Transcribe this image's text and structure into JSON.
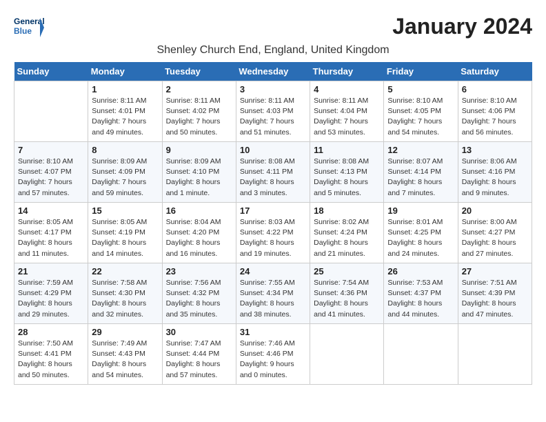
{
  "header": {
    "logo_general": "General",
    "logo_blue": "Blue",
    "month": "January 2024",
    "location": "Shenley Church End, England, United Kingdom"
  },
  "weekdays": [
    "Sunday",
    "Monday",
    "Tuesday",
    "Wednesday",
    "Thursday",
    "Friday",
    "Saturday"
  ],
  "weeks": [
    [
      {
        "day": "",
        "sunrise": "",
        "sunset": "",
        "daylight": ""
      },
      {
        "day": "1",
        "sunrise": "Sunrise: 8:11 AM",
        "sunset": "Sunset: 4:01 PM",
        "daylight": "Daylight: 7 hours and 49 minutes."
      },
      {
        "day": "2",
        "sunrise": "Sunrise: 8:11 AM",
        "sunset": "Sunset: 4:02 PM",
        "daylight": "Daylight: 7 hours and 50 minutes."
      },
      {
        "day": "3",
        "sunrise": "Sunrise: 8:11 AM",
        "sunset": "Sunset: 4:03 PM",
        "daylight": "Daylight: 7 hours and 51 minutes."
      },
      {
        "day": "4",
        "sunrise": "Sunrise: 8:11 AM",
        "sunset": "Sunset: 4:04 PM",
        "daylight": "Daylight: 7 hours and 53 minutes."
      },
      {
        "day": "5",
        "sunrise": "Sunrise: 8:10 AM",
        "sunset": "Sunset: 4:05 PM",
        "daylight": "Daylight: 7 hours and 54 minutes."
      },
      {
        "day": "6",
        "sunrise": "Sunrise: 8:10 AM",
        "sunset": "Sunset: 4:06 PM",
        "daylight": "Daylight: 7 hours and 56 minutes."
      }
    ],
    [
      {
        "day": "7",
        "sunrise": "Sunrise: 8:10 AM",
        "sunset": "Sunset: 4:07 PM",
        "daylight": "Daylight: 7 hours and 57 minutes."
      },
      {
        "day": "8",
        "sunrise": "Sunrise: 8:09 AM",
        "sunset": "Sunset: 4:09 PM",
        "daylight": "Daylight: 7 hours and 59 minutes."
      },
      {
        "day": "9",
        "sunrise": "Sunrise: 8:09 AM",
        "sunset": "Sunset: 4:10 PM",
        "daylight": "Daylight: 8 hours and 1 minute."
      },
      {
        "day": "10",
        "sunrise": "Sunrise: 8:08 AM",
        "sunset": "Sunset: 4:11 PM",
        "daylight": "Daylight: 8 hours and 3 minutes."
      },
      {
        "day": "11",
        "sunrise": "Sunrise: 8:08 AM",
        "sunset": "Sunset: 4:13 PM",
        "daylight": "Daylight: 8 hours and 5 minutes."
      },
      {
        "day": "12",
        "sunrise": "Sunrise: 8:07 AM",
        "sunset": "Sunset: 4:14 PM",
        "daylight": "Daylight: 8 hours and 7 minutes."
      },
      {
        "day": "13",
        "sunrise": "Sunrise: 8:06 AM",
        "sunset": "Sunset: 4:16 PM",
        "daylight": "Daylight: 8 hours and 9 minutes."
      }
    ],
    [
      {
        "day": "14",
        "sunrise": "Sunrise: 8:05 AM",
        "sunset": "Sunset: 4:17 PM",
        "daylight": "Daylight: 8 hours and 11 minutes."
      },
      {
        "day": "15",
        "sunrise": "Sunrise: 8:05 AM",
        "sunset": "Sunset: 4:19 PM",
        "daylight": "Daylight: 8 hours and 14 minutes."
      },
      {
        "day": "16",
        "sunrise": "Sunrise: 8:04 AM",
        "sunset": "Sunset: 4:20 PM",
        "daylight": "Daylight: 8 hours and 16 minutes."
      },
      {
        "day": "17",
        "sunrise": "Sunrise: 8:03 AM",
        "sunset": "Sunset: 4:22 PM",
        "daylight": "Daylight: 8 hours and 19 minutes."
      },
      {
        "day": "18",
        "sunrise": "Sunrise: 8:02 AM",
        "sunset": "Sunset: 4:24 PM",
        "daylight": "Daylight: 8 hours and 21 minutes."
      },
      {
        "day": "19",
        "sunrise": "Sunrise: 8:01 AM",
        "sunset": "Sunset: 4:25 PM",
        "daylight": "Daylight: 8 hours and 24 minutes."
      },
      {
        "day": "20",
        "sunrise": "Sunrise: 8:00 AM",
        "sunset": "Sunset: 4:27 PM",
        "daylight": "Daylight: 8 hours and 27 minutes."
      }
    ],
    [
      {
        "day": "21",
        "sunrise": "Sunrise: 7:59 AM",
        "sunset": "Sunset: 4:29 PM",
        "daylight": "Daylight: 8 hours and 29 minutes."
      },
      {
        "day": "22",
        "sunrise": "Sunrise: 7:58 AM",
        "sunset": "Sunset: 4:30 PM",
        "daylight": "Daylight: 8 hours and 32 minutes."
      },
      {
        "day": "23",
        "sunrise": "Sunrise: 7:56 AM",
        "sunset": "Sunset: 4:32 PM",
        "daylight": "Daylight: 8 hours and 35 minutes."
      },
      {
        "day": "24",
        "sunrise": "Sunrise: 7:55 AM",
        "sunset": "Sunset: 4:34 PM",
        "daylight": "Daylight: 8 hours and 38 minutes."
      },
      {
        "day": "25",
        "sunrise": "Sunrise: 7:54 AM",
        "sunset": "Sunset: 4:36 PM",
        "daylight": "Daylight: 8 hours and 41 minutes."
      },
      {
        "day": "26",
        "sunrise": "Sunrise: 7:53 AM",
        "sunset": "Sunset: 4:37 PM",
        "daylight": "Daylight: 8 hours and 44 minutes."
      },
      {
        "day": "27",
        "sunrise": "Sunrise: 7:51 AM",
        "sunset": "Sunset: 4:39 PM",
        "daylight": "Daylight: 8 hours and 47 minutes."
      }
    ],
    [
      {
        "day": "28",
        "sunrise": "Sunrise: 7:50 AM",
        "sunset": "Sunset: 4:41 PM",
        "daylight": "Daylight: 8 hours and 50 minutes."
      },
      {
        "day": "29",
        "sunrise": "Sunrise: 7:49 AM",
        "sunset": "Sunset: 4:43 PM",
        "daylight": "Daylight: 8 hours and 54 minutes."
      },
      {
        "day": "30",
        "sunrise": "Sunrise: 7:47 AM",
        "sunset": "Sunset: 4:44 PM",
        "daylight": "Daylight: 8 hours and 57 minutes."
      },
      {
        "day": "31",
        "sunrise": "Sunrise: 7:46 AM",
        "sunset": "Sunset: 4:46 PM",
        "daylight": "Daylight: 9 hours and 0 minutes."
      },
      {
        "day": "",
        "sunrise": "",
        "sunset": "",
        "daylight": ""
      },
      {
        "day": "",
        "sunrise": "",
        "sunset": "",
        "daylight": ""
      },
      {
        "day": "",
        "sunrise": "",
        "sunset": "",
        "daylight": ""
      }
    ]
  ]
}
